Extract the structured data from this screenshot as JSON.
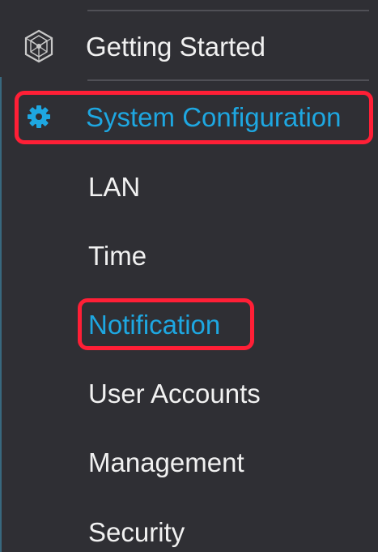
{
  "navigation": {
    "getting_started": {
      "label": "Getting Started",
      "icon": "getting-started-icon"
    },
    "system_configuration": {
      "label": "System Configuration",
      "icon": "gear-icon"
    },
    "sub_items": [
      {
        "label": "LAN"
      },
      {
        "label": "Time"
      },
      {
        "label": "Notification"
      },
      {
        "label": "User Accounts"
      },
      {
        "label": "Management"
      },
      {
        "label": "Security"
      }
    ]
  },
  "colors": {
    "background": "#2f2f34",
    "text": "#f1f1f1",
    "accent": "#1ea7e1",
    "highlight": "#ff1f36",
    "divider": "#505056"
  }
}
